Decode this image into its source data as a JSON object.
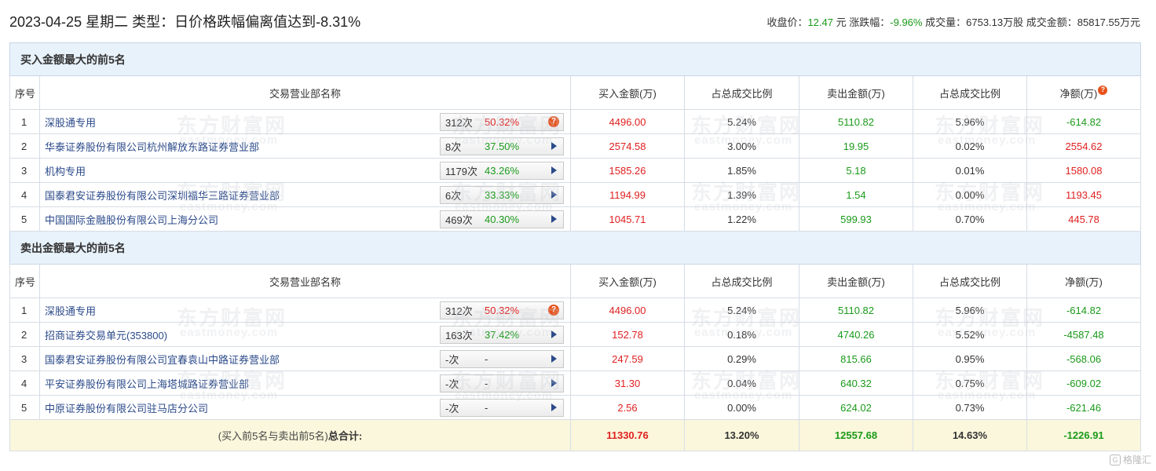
{
  "header": {
    "title": "2023-04-25 星期二 类型：日价格跌幅偏离值达到-8.31%",
    "close_label": "收盘价：",
    "close_value": "12.47",
    "close_unit": "元",
    "change_label": "涨跌幅：",
    "change_value": "-9.96%",
    "volume_label": "成交量：",
    "volume_value": "6753.13万股",
    "amount_label": "成交金额：",
    "amount_value": "85817.55万元"
  },
  "columns": {
    "idx": "序号",
    "name": "交易营业部名称",
    "buy": "买入金额(万)",
    "buy_ratio": "占总成交比例",
    "sell": "卖出金额(万)",
    "sell_ratio": "占总成交比例",
    "net": "净额(万)"
  },
  "buy_section": {
    "title": "买入金额最大的前5名",
    "rows": [
      {
        "idx": "1",
        "name": "深股通专用",
        "count": "312次",
        "rate": "50.32%",
        "rate_color": "red",
        "icon": "question-icon",
        "buy": "4496.00",
        "buy_ratio": "5.24%",
        "sell": "5110.82",
        "sell_ratio": "5.96%",
        "net": "-614.82",
        "net_color": "green"
      },
      {
        "idx": "2",
        "name": "华泰证券股份有限公司杭州解放东路证券营业部",
        "count": "8次",
        "rate": "37.50%",
        "rate_color": "green",
        "icon": "arrow-right-icon",
        "buy": "2574.58",
        "buy_ratio": "3.00%",
        "sell": "19.95",
        "sell_ratio": "0.02%",
        "net": "2554.62",
        "net_color": "red"
      },
      {
        "idx": "3",
        "name": "机构专用",
        "count": "1179次",
        "rate": "43.26%",
        "rate_color": "green",
        "icon": "arrow-right-icon",
        "buy": "1585.26",
        "buy_ratio": "1.85%",
        "sell": "5.18",
        "sell_ratio": "0.01%",
        "net": "1580.08",
        "net_color": "red"
      },
      {
        "idx": "4",
        "name": "国泰君安证券股份有限公司深圳福华三路证券营业部",
        "count": "6次",
        "rate": "33.33%",
        "rate_color": "green",
        "icon": "arrow-right-icon",
        "buy": "1194.99",
        "buy_ratio": "1.39%",
        "sell": "1.54",
        "sell_ratio": "0.00%",
        "net": "1193.45",
        "net_color": "red"
      },
      {
        "idx": "5",
        "name": "中国国际金融股份有限公司上海分公司",
        "count": "469次",
        "rate": "40.30%",
        "rate_color": "green",
        "icon": "arrow-right-icon",
        "buy": "1045.71",
        "buy_ratio": "1.22%",
        "sell": "599.93",
        "sell_ratio": "0.70%",
        "net": "445.78",
        "net_color": "red"
      }
    ]
  },
  "sell_section": {
    "title": "卖出金额最大的前5名",
    "rows": [
      {
        "idx": "1",
        "name": "深股通专用",
        "count": "312次",
        "rate": "50.32%",
        "rate_color": "red",
        "icon": "question-icon",
        "buy": "4496.00",
        "buy_ratio": "5.24%",
        "sell": "5110.82",
        "sell_ratio": "5.96%",
        "net": "-614.82",
        "net_color": "green"
      },
      {
        "idx": "2",
        "name": "招商证券交易单元(353800)",
        "count": "163次",
        "rate": "37.42%",
        "rate_color": "green",
        "icon": "arrow-right-icon",
        "buy": "152.78",
        "buy_ratio": "0.18%",
        "sell": "4740.26",
        "sell_ratio": "5.52%",
        "net": "-4587.48",
        "net_color": "green"
      },
      {
        "idx": "3",
        "name": "国泰君安证券股份有限公司宜春袁山中路证券营业部",
        "count": "-次",
        "rate": "-",
        "rate_color": "dash",
        "icon": "arrow-right-icon",
        "buy": "247.59",
        "buy_ratio": "0.29%",
        "sell": "815.66",
        "sell_ratio": "0.95%",
        "net": "-568.06",
        "net_color": "green"
      },
      {
        "idx": "4",
        "name": "平安证券股份有限公司上海塔城路证券营业部",
        "count": "-次",
        "rate": "-",
        "rate_color": "dash",
        "icon": "arrow-right-icon",
        "buy": "31.30",
        "buy_ratio": "0.04%",
        "sell": "640.32",
        "sell_ratio": "0.75%",
        "net": "-609.02",
        "net_color": "green"
      },
      {
        "idx": "5",
        "name": "中原证券股份有限公司驻马店分公司",
        "count": "-次",
        "rate": "-",
        "rate_color": "dash",
        "icon": "arrow-right-icon",
        "buy": "2.56",
        "buy_ratio": "0.00%",
        "sell": "624.02",
        "sell_ratio": "0.73%",
        "net": "-621.46",
        "net_color": "green"
      }
    ]
  },
  "total": {
    "label_prefix": "(买入前5名与卖出前5名)",
    "label_bold": "总合计:",
    "buy": "11330.76",
    "buy_ratio": "13.20%",
    "sell": "12557.68",
    "sell_ratio": "14.63%",
    "net": "-1226.91"
  },
  "watermark": {
    "cn": "东方财富网",
    "en": "eastmoney.com"
  },
  "brand": {
    "glyph": "G",
    "text": "格隆汇"
  },
  "colors": {
    "red": "#e02020",
    "green": "#1a9a1a",
    "link": "#2b4a8a",
    "section_bg": "#e8f2fb",
    "total_bg": "#fbf7dc"
  }
}
